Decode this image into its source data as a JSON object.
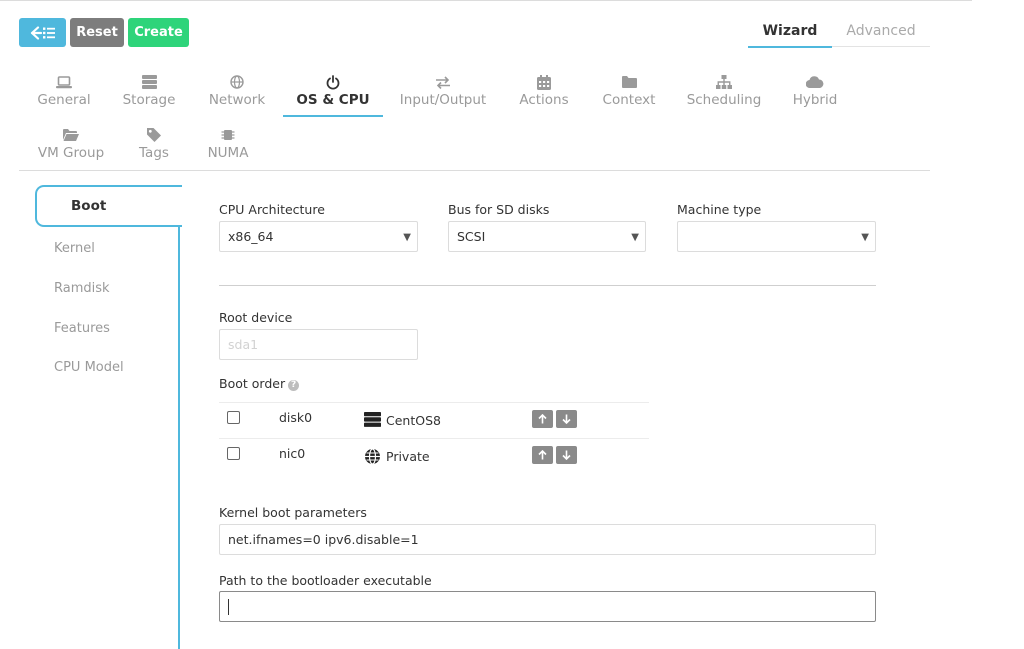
{
  "toolbar": {
    "back_icon": "back-list-icon",
    "reset_label": "Reset",
    "create_label": "Create"
  },
  "mode_tabs": {
    "wizard": "Wizard",
    "advanced": "Advanced"
  },
  "section_tabs": [
    {
      "label": "General",
      "icon": "laptop-icon"
    },
    {
      "label": "Storage",
      "icon": "server-icon"
    },
    {
      "label": "Network",
      "icon": "globe-icon"
    },
    {
      "label": "OS & CPU",
      "icon": "power-icon",
      "active": true
    },
    {
      "label": "Input/Output",
      "icon": "exchange-icon"
    },
    {
      "label": "Actions",
      "icon": "calendar-icon"
    },
    {
      "label": "Context",
      "icon": "folder-icon"
    },
    {
      "label": "Scheduling",
      "icon": "sitemap-icon"
    },
    {
      "label": "Hybrid",
      "icon": "cloud-icon"
    },
    {
      "label": "VM Group",
      "icon": "folder-open-icon"
    },
    {
      "label": "Tags",
      "icon": "tag-icon"
    },
    {
      "label": "NUMA",
      "icon": "chip-icon"
    }
  ],
  "side_nav": [
    {
      "label": "Boot",
      "active": true
    },
    {
      "label": "Kernel"
    },
    {
      "label": "Ramdisk"
    },
    {
      "label": "Features"
    },
    {
      "label": "CPU Model"
    }
  ],
  "form": {
    "cpu_arch": {
      "label": "CPU Architecture",
      "value": "x86_64"
    },
    "bus_sd": {
      "label": "Bus for SD disks",
      "value": "SCSI"
    },
    "machine_type": {
      "label": "Machine type",
      "value": ""
    },
    "root_device": {
      "label": "Root device",
      "placeholder": "sda1"
    },
    "boot_order": {
      "label": "Boot order",
      "help_glyph": "?",
      "items": [
        {
          "name": "disk0",
          "label": "CentOS8",
          "icon": "server-icon"
        },
        {
          "name": "nic0",
          "label": "Private",
          "icon": "globe-icon"
        }
      ]
    },
    "kernel_params": {
      "label": "Kernel boot parameters",
      "value": "net.ifnames=0 ipv6.disable=1"
    },
    "bootloader_path": {
      "label": "Path to the bootloader executable",
      "value": ""
    }
  },
  "colors": {
    "accent": "#4fb8dd",
    "reset": "#7d7d7d",
    "create": "#2ed47a"
  }
}
